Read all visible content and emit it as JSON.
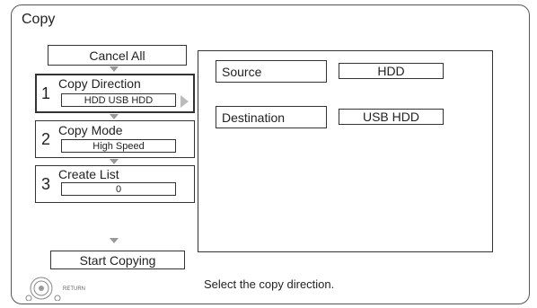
{
  "title": "Copy",
  "cancel_all": "Cancel All",
  "steps": [
    {
      "number": "1",
      "label": "Copy Direction",
      "value": "HDD USB HDD"
    },
    {
      "number": "2",
      "label": "Copy Mode",
      "value": "High Speed"
    },
    {
      "number": "3",
      "label": "Create List",
      "value": "0"
    }
  ],
  "start_copying": "Start Copying",
  "source": {
    "label": "Source",
    "value": "HDD"
  },
  "destination": {
    "label": "Destination",
    "value": "USB HDD"
  },
  "hint": "Select the copy direction.",
  "return_label": "RETURN"
}
